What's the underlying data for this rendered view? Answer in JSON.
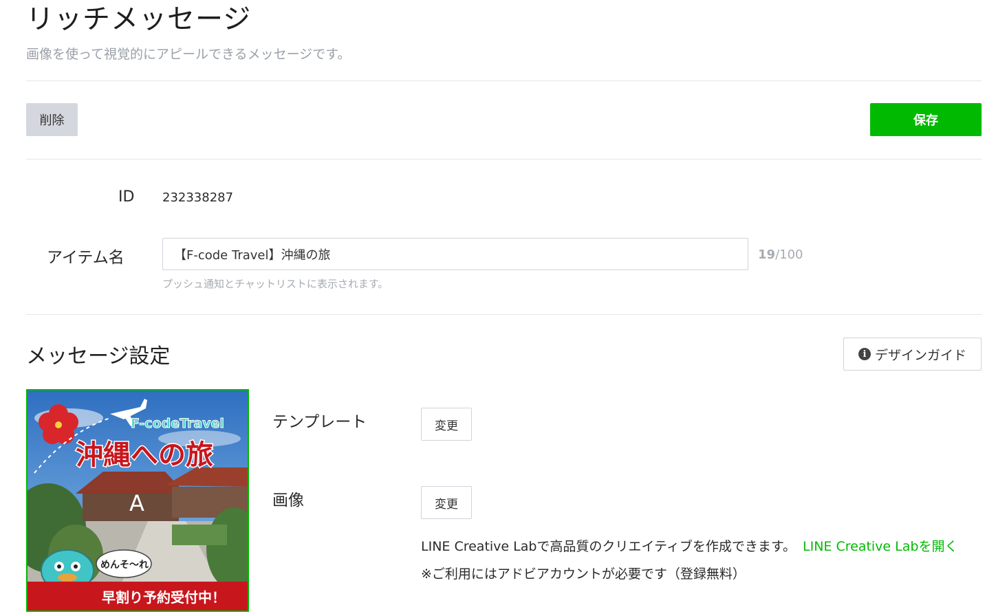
{
  "header": {
    "title": "リッチメッセージ",
    "subtitle": "画像を使って視覚的にアピールできるメッセージです。"
  },
  "toolbar": {
    "delete_label": "削除",
    "save_label": "保存"
  },
  "form": {
    "id_label": "ID",
    "id_value": "232338287",
    "name_label": "アイテム名",
    "name_value": "【F-code Travel】沖縄の旅",
    "name_count": "19",
    "name_max": "/100",
    "name_hint": "プッシュ通知とチャットリストに表示されます。"
  },
  "message_settings": {
    "title": "メッセージ設定",
    "design_guide_label": "デザインガイド",
    "template_label": "テンプレート",
    "image_label": "画像",
    "change_label": "変更",
    "lab_text": "LINE Creative Labで高品質のクリエイティブを作成できます。",
    "lab_link": "LINE Creative Labを開く",
    "note": "※ご利用にはアドビアカウントが必要です（登録無料）"
  },
  "preview": {
    "brand": "F-codeTravel",
    "headline": "沖縄への旅",
    "area_label": "A",
    "bubble": "めんそ〜れ",
    "banner": "早割り予約受付中！"
  },
  "colors": {
    "accent": "#00b900",
    "muted": "#a6abb2",
    "banner_red": "#c8161d"
  }
}
